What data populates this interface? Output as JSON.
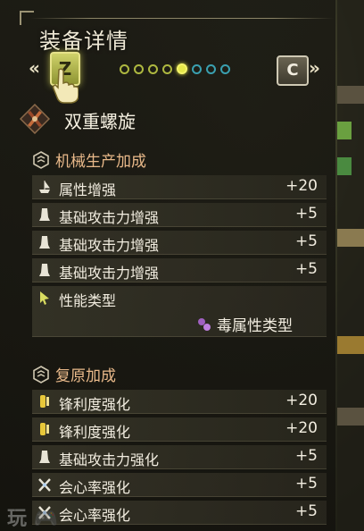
{
  "header": {
    "title": "装备详情",
    "nav_left_glyph": "«",
    "key_left": "Z",
    "key_right": "C",
    "nav_right_glyph": "»",
    "page_dots": {
      "count": 8,
      "active_index": 4
    }
  },
  "weapon": {
    "name": "双重螺旋",
    "icon": "dual-blades-icon"
  },
  "sections": [
    {
      "title": "机械生产加成",
      "icon": "hex-badge-icon",
      "rows": [
        {
          "icon": "boat-icon",
          "label": "属性增强",
          "value": "+20"
        },
        {
          "icon": "tooth-icon",
          "label": "基础攻击力增强",
          "value": "+5"
        },
        {
          "icon": "tooth-icon",
          "label": "基础攻击力增强",
          "value": "+5"
        },
        {
          "icon": "tooth-icon",
          "label": "基础攻击力增强",
          "value": "+5"
        },
        {
          "icon": "cursor-icon",
          "label": "性能类型",
          "value": "",
          "sub_icon": "poison-gem-icon",
          "sub_value": "毒属性类型"
        }
      ]
    },
    {
      "title": "复原加成",
      "icon": "hex-badge-icon",
      "rows": [
        {
          "icon": "whetstone-icon",
          "label": "锋利度强化",
          "value": "+20"
        },
        {
          "icon": "whetstone-icon",
          "label": "锋利度强化",
          "value": "+20"
        },
        {
          "icon": "tooth-icon",
          "label": "基础攻击力强化",
          "value": "+5"
        },
        {
          "icon": "crossed-blades-icon",
          "label": "会心率强化",
          "value": "+5"
        },
        {
          "icon": "crossed-blades-icon",
          "label": "会心率强化",
          "value": "+5"
        }
      ]
    }
  ],
  "watermark": "玩 🎮",
  "colors": {
    "section_title": "#e9b98a",
    "active_dot": "#e6e84a",
    "key_highlight": "#cfd26a"
  }
}
